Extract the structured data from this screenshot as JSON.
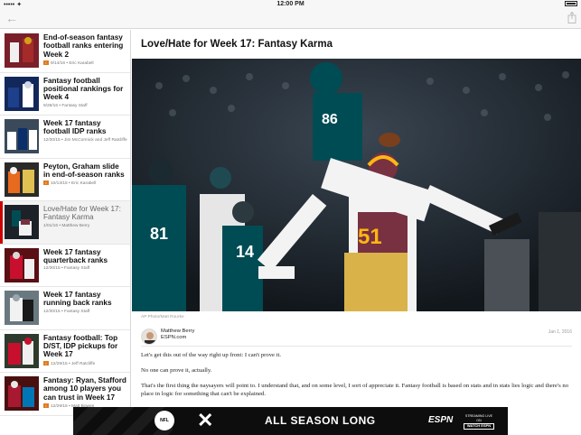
{
  "status_bar": {
    "carrier": "•••••  ✦",
    "time": "12:00 PM"
  },
  "nav": {
    "back_icon": "arrow-left-icon",
    "share_icon": "share-icon"
  },
  "sidebar": {
    "items": [
      {
        "title": "End-of-season fantasy football ranks entering Week 2",
        "meta": "9/14/16 • Eric Karabell",
        "insider": true
      },
      {
        "title": "Fantasy football positional rankings for Week 4",
        "meta": "9/28/16 • Fantasy Staff",
        "insider": false
      },
      {
        "title": "Week 17 fantasy football IDP ranks",
        "meta": "12/30/15 • Jim McCormick and Jeff Ratcliffe",
        "insider": false
      },
      {
        "title": "Peyton, Graham slide in end-of-season ranks",
        "meta": "10/13/15 • Eric Karabell",
        "insider": true
      },
      {
        "title": "Love/Hate for Week 17: Fantasy Karma",
        "meta": "1/01/16 • Matthew Berry",
        "insider": false,
        "active": true
      },
      {
        "title": "Week 17 fantasy quarterback ranks",
        "meta": "12/30/15 • Fantasy Staff",
        "insider": false
      },
      {
        "title": "Week 17 fantasy running back ranks",
        "meta": "12/30/15 • Fantasy Staff",
        "insider": false
      },
      {
        "title": "Fantasy football: Top D/ST, IDP pickups for Week 17",
        "meta": "12/29/15 • Jeff Ratcliffe",
        "insider": true
      },
      {
        "title": "Fantasy: Ryan, Stafford among 10 players you can trust in Week 17",
        "meta": "12/29/15 • Matt Bowen",
        "insider": true
      }
    ]
  },
  "article": {
    "headline": "Love/Hate for Week 17: Fantasy Karma",
    "photo_caption": "AP Photo/Matt Rourke",
    "author": "Matthew Berry",
    "outlet": "ESPN.com",
    "date": "Jan 1, 2016",
    "paragraphs": [
      "Let's get this out of the way right up front: I can't prove it.",
      "No one can prove it, actually.",
      "That's the first thing the naysayers will point to. I understand that, and on some level, I sort of appreciate it. Fantasy football is based on stats and in stats lies logic and there's no place in logic for something that can't be explained."
    ]
  },
  "ad": {
    "logo": "NFL",
    "slogan": "ALL SEASON LONG",
    "brand": "ESPN",
    "watch_line1": "STREAMING LIVE ON",
    "watch_line2": "WATCH ESPN"
  },
  "colors": {
    "accent": "#cc0000",
    "insider": "#e07b1f",
    "eagles_green": "#004c54",
    "redskins_burgundy": "#773141"
  }
}
